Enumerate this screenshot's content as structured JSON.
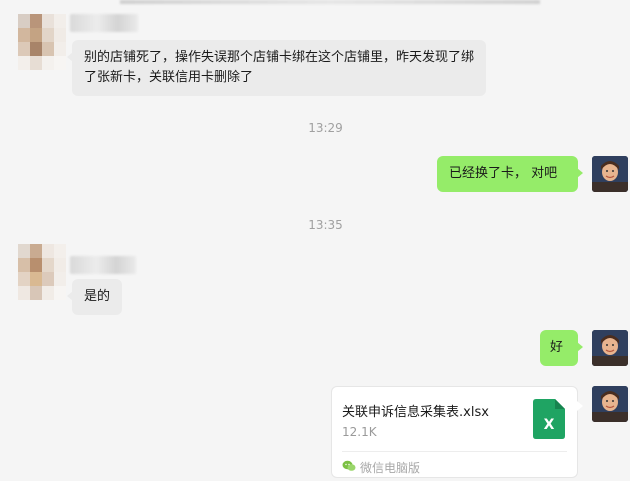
{
  "messages": [
    {
      "text": "别的店铺死了，操作失误那个店铺卡绑在这个店铺里，昨天发现了绑了张新卡，关联信用卡删除了"
    },
    {
      "time": "13:29"
    },
    {
      "text": "已经换了卡， 对吧"
    },
    {
      "time": "13:35"
    },
    {
      "text": "是的"
    },
    {
      "text": "好"
    },
    {
      "file": {
        "name": "关联申诉信息采集表.xlsx",
        "size": "12.1K",
        "source": "微信电脑版",
        "icon": "excel-icon",
        "icon_letter": "X"
      }
    }
  ],
  "colors": {
    "incoming_bubble": "#ebebeb",
    "outgoing_bubble": "#95ec69",
    "background": "#f5f5f5",
    "excel_green": "#1fa463"
  }
}
